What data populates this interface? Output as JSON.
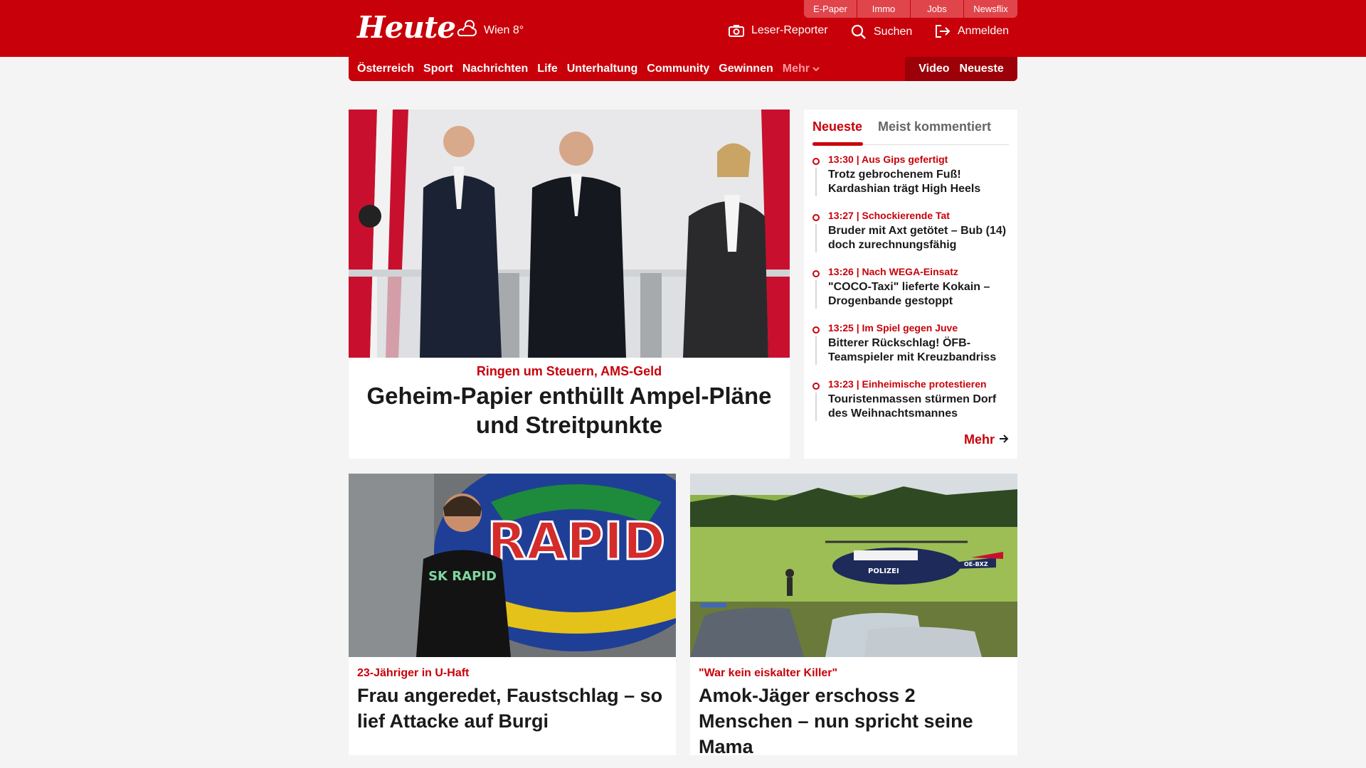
{
  "header": {
    "logo": "Heute",
    "weather_label": "Wien 8°",
    "services": [
      "E-Paper",
      "Immo",
      "Jobs",
      "Newsflix"
    ],
    "leser_reporter": "Leser-Reporter",
    "search": "Suchen",
    "login": "Anmelden"
  },
  "nav": {
    "items": [
      "Österreich",
      "Sport",
      "Nachrichten",
      "Life",
      "Unterhaltung",
      "Community",
      "Gewinnen"
    ],
    "more": "Mehr",
    "video": "Video",
    "latest": "Neueste"
  },
  "hero": {
    "kicker": "Ringen um Steuern, AMS-Geld",
    "title": "Geheim-Papier enthüllt Ampel-Pläne und Streitpunkte"
  },
  "sidebar": {
    "tabs": [
      "Neueste",
      "Meist kommentiert"
    ],
    "items": [
      {
        "meta": "13:30 | Aus Gips gefertigt",
        "title": "Trotz gebrochenem Fuß! Kardashian trägt High Heels"
      },
      {
        "meta": "13:27 | Schockierende Tat",
        "title": "Bruder mit Axt getötet – Bub (14) doch zurechnungsfähig"
      },
      {
        "meta": "13:26 | Nach WEGA-Einsatz",
        "title": "\"COCO-Taxi\" lieferte Kokain – Drogenbande gestoppt"
      },
      {
        "meta": "13:25 | Im Spiel gegen Juve",
        "title": "Bitterer Rückschlag! ÖFB-Teamspieler mit Kreuzbandriss"
      },
      {
        "meta": "13:23 | Einheimische protestieren",
        "title": "Touristenmassen stürmen Dorf des Weihnachtsmannes"
      }
    ],
    "more": "Mehr"
  },
  "cards": [
    {
      "kicker": "23-Jähriger in U-Haft",
      "title": "Frau angeredet, Faustschlag – so lief Attacke auf Burgi",
      "shirt_text": "SK RAPID",
      "wall_text": "RAPID"
    },
    {
      "kicker": "\"War kein eiskalter Killer\"",
      "title": "Amok-Jäger erschoss 2 Menschen – nun spricht seine Mama",
      "heli_text": "POLIZEI",
      "reg_text": "OE-BXZ"
    }
  ],
  "colors": {
    "brand": "#c8000a",
    "brand_dark": "#9c0008"
  },
  "icons": {
    "weather": "cloud-sun-icon",
    "camera": "camera-icon",
    "search": "search-icon",
    "login": "login-icon"
  }
}
